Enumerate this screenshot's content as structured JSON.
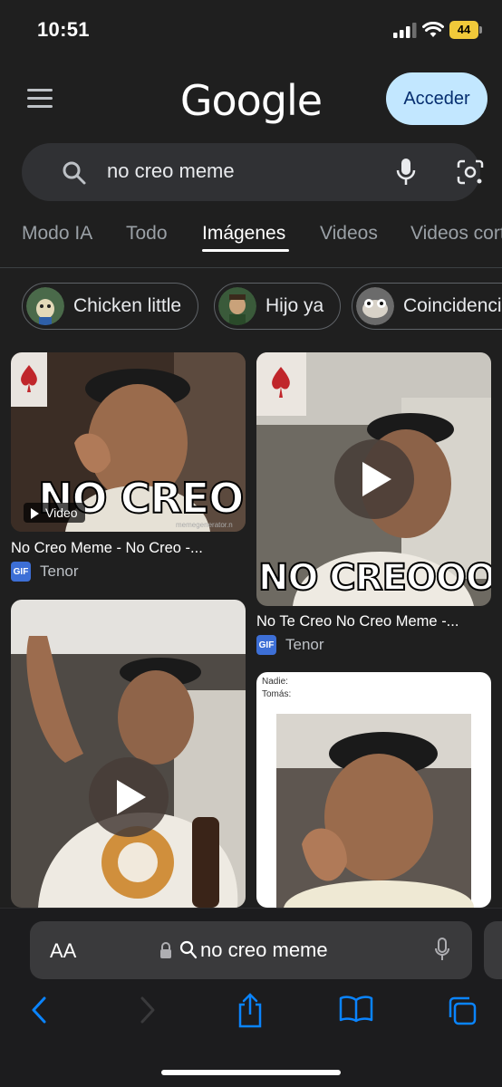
{
  "status_bar": {
    "time": "10:51",
    "battery": "44"
  },
  "header": {
    "logo": "Google",
    "signin_label": "Acceder"
  },
  "search": {
    "query": "no creo meme"
  },
  "tabs": [
    {
      "label": "Modo IA",
      "active": false
    },
    {
      "label": "Todo",
      "active": false
    },
    {
      "label": "Imágenes",
      "active": true
    },
    {
      "label": "Videos",
      "active": false
    },
    {
      "label": "Videos cortos",
      "active": false
    }
  ],
  "chips": [
    {
      "label": "Chicken little"
    },
    {
      "label": "Hijo ya"
    },
    {
      "label": "Coincidencia"
    }
  ],
  "results": [
    {
      "title": "No Creo Meme - No Creo -...",
      "source": "Tenor",
      "badge": "Video",
      "caption": "NO CREO",
      "watermark": "memegenerator.n"
    },
    {
      "title": "No Te Creo No Creo Meme -...",
      "source": "Tenor",
      "caption": "NO CREOOO!"
    },
    {
      "title": "",
      "source": ""
    },
    {
      "title": "",
      "source": "",
      "meme_text_1": "Nadie:",
      "meme_text_2": "Tomás:"
    }
  ],
  "gif_label": "GIF",
  "browser": {
    "text_size_label": "AA",
    "address": "no creo meme"
  },
  "colors": {
    "background": "#1f1f1f",
    "accent_button": "#c2e7ff",
    "search_box": "#303134",
    "ios_blue": "#0a84ff"
  }
}
